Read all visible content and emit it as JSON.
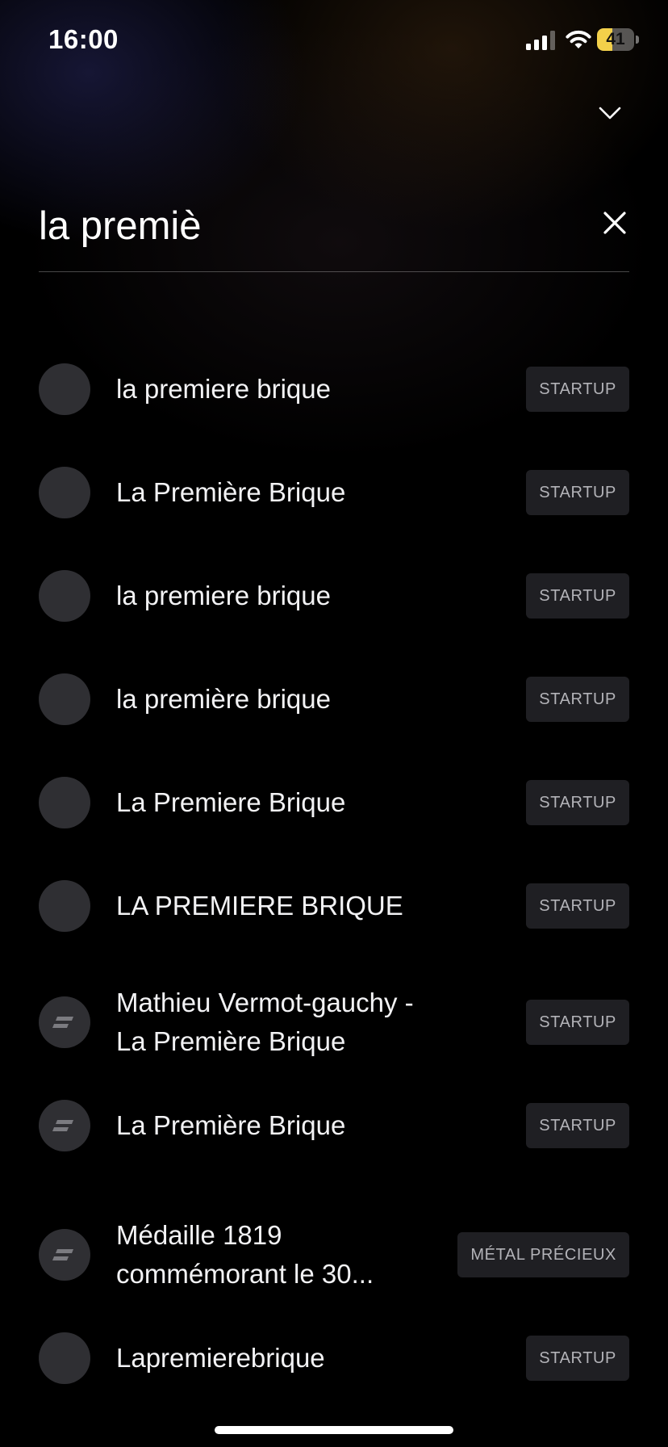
{
  "status_bar": {
    "time": "16:00",
    "battery_level": "41",
    "battery_fraction": 0.41
  },
  "header": {
    "collapse_icon": "chevron-down-icon"
  },
  "search": {
    "value": "la premiè",
    "clear_icon": "close-icon"
  },
  "results": [
    {
      "name_lines": [
        "la premiere brique"
      ],
      "category": "STARTUP",
      "avatar": "placeholder"
    },
    {
      "name_lines": [
        "La Première Brique"
      ],
      "category": "STARTUP",
      "avatar": "placeholder"
    },
    {
      "name_lines": [
        "la premiere brique"
      ],
      "category": "STARTUP",
      "avatar": "placeholder"
    },
    {
      "name_lines": [
        "la première brique"
      ],
      "category": "STARTUP",
      "avatar": "placeholder"
    },
    {
      "name_lines": [
        "La Premiere Brique"
      ],
      "category": "STARTUP",
      "avatar": "placeholder"
    },
    {
      "name_lines": [
        "LA PREMIERE BRIQUE"
      ],
      "category": "STARTUP",
      "avatar": "placeholder"
    },
    {
      "name_lines": [
        "Mathieu Vermot-gauchy -",
        "La Première Brique"
      ],
      "category": "STARTUP",
      "avatar": "brand-logo"
    },
    {
      "name_lines": [
        "La Première Brique"
      ],
      "category": "STARTUP",
      "avatar": "brand-logo"
    },
    {
      "name_lines": [
        "Médaille 1819",
        "commémorant le 30..."
      ],
      "category": "MÉTAL PRÉCIEUX",
      "avatar": "brand-logo"
    },
    {
      "name_lines": [
        "Lapremierebrique"
      ],
      "category": "STARTUP",
      "avatar": "placeholder"
    }
  ]
}
